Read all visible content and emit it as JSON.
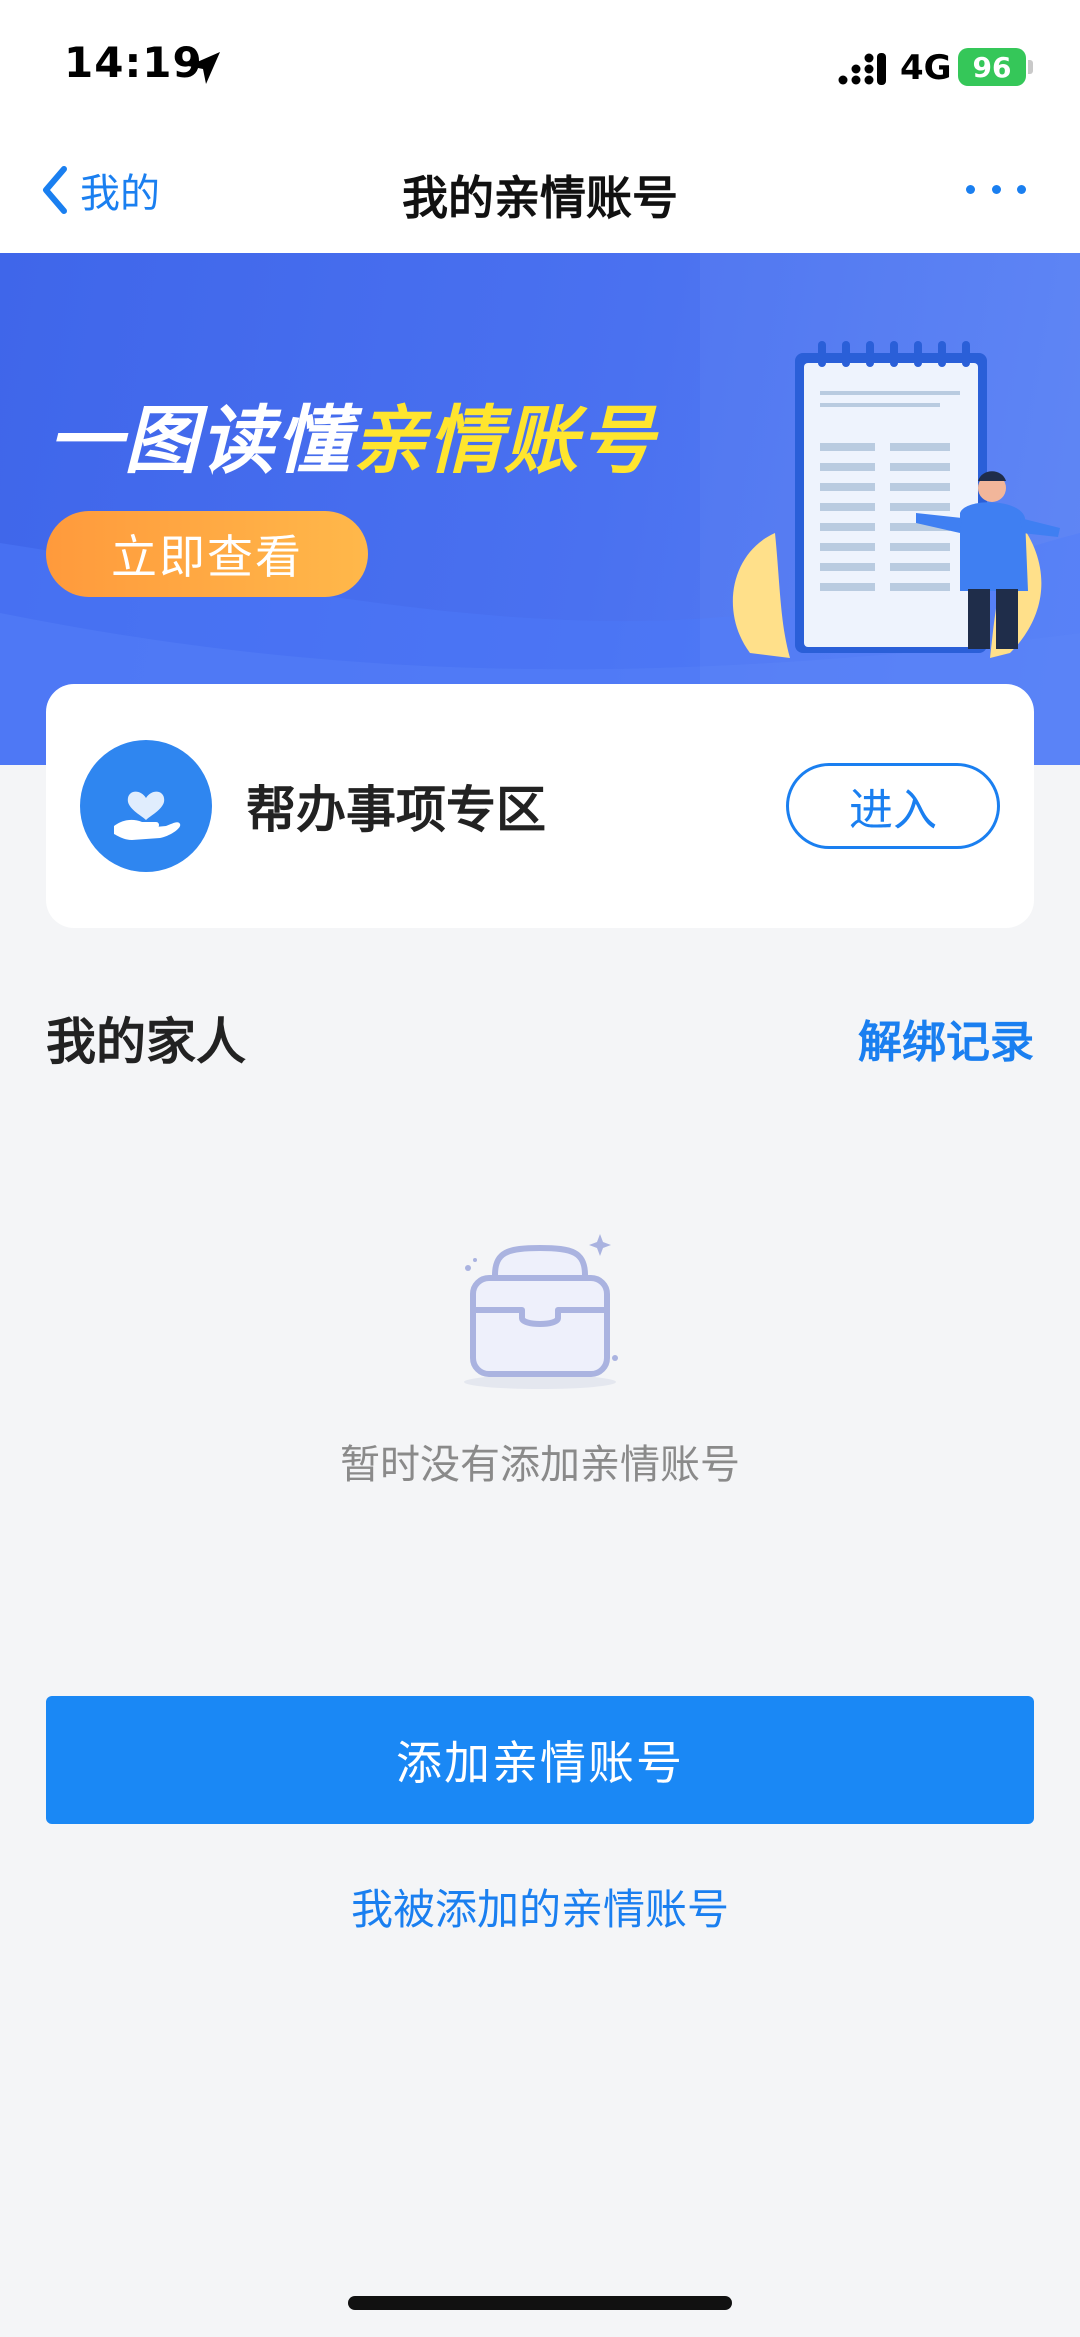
{
  "status_bar": {
    "time": "14:19",
    "network": "4G",
    "battery": "96"
  },
  "nav": {
    "back_label": "我的",
    "title": "我的亲情账号"
  },
  "banner": {
    "headline_white": "一图读懂",
    "headline_yellow": "亲情账号",
    "cta_label": "立即查看"
  },
  "service_card": {
    "title": "帮办事项专区",
    "enter_label": "进入"
  },
  "family_section": {
    "title": "我的家人",
    "unbind_link": "解绑记录",
    "empty_text": "暂时没有添加亲情账号"
  },
  "actions": {
    "add_button": "添加亲情账号",
    "added_by_link": "我被添加的亲情账号"
  },
  "colors": {
    "accent": "#1a7ff0",
    "primary_button": "#1a88f5",
    "banner_bg": "#4a71f0",
    "highlight_yellow": "#ffe52e",
    "cta_orange": "#ffa842",
    "battery_green": "#35c759"
  }
}
